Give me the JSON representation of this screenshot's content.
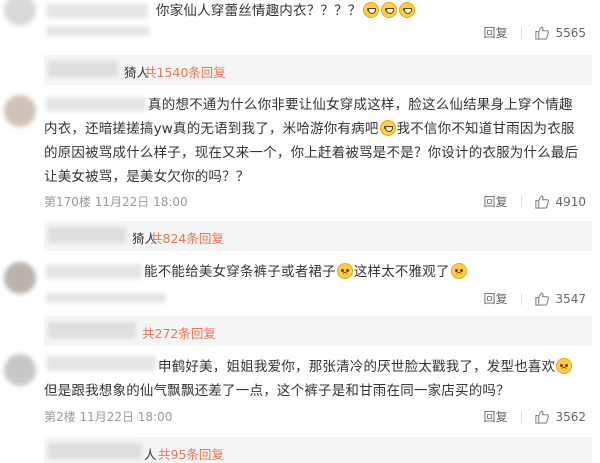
{
  "comments": [
    {
      "text": "你家仙人穿蕾丝情趣内衣？？？？",
      "meta": "",
      "reply_label": "回复",
      "likes": "5565",
      "sub": {
        "author_tail": "猗人",
        "count_text": "共1540条回复"
      }
    },
    {
      "text_parts": [
        "真的想不通为什么你非要让仙女穿成这样，脸这么仙结果身上穿个情趣内衣，还暗搓搓搞yw真的无语到我了，米哈游你有病吧",
        "我不信你不知道甘雨因为衣服的原因被骂成什么样子，现在又来一个，你上赶着被骂是不是？你设计的衣服为什么最后让美女被骂，是美女欠你的吗？？"
      ],
      "meta": "第170楼  11月22日  18:00",
      "reply_label": "回复",
      "likes": "4910",
      "sub": {
        "author_tail": "猗人",
        "count_text": "共824条回复"
      }
    },
    {
      "text_parts": [
        "能不能给美女穿条裤子或者裙子",
        "这样太不雅观了"
      ],
      "meta": "",
      "reply_label": "回复",
      "likes": "3547",
      "sub": {
        "author_tail": "",
        "count_text": "共272条回复"
      }
    },
    {
      "text_parts": [
        "申鹤好美，姐姐我爱你，那张清冷的厌世脸太戳我了，发型也喜欢",
        "但是跟我想象的仙气飘飘还差了一点，这个裤子是和甘雨在同一家店买的吗？"
      ],
      "meta": "第2楼  11月22日  18:00",
      "reply_label": "回复",
      "likes": "3562",
      "sub": {
        "author_tail": "人",
        "count_text": "共95条回复"
      }
    }
  ],
  "colors": {
    "accent": "#eb7350",
    "meta": "#999999",
    "reply_bg": "#f5f5f5"
  }
}
